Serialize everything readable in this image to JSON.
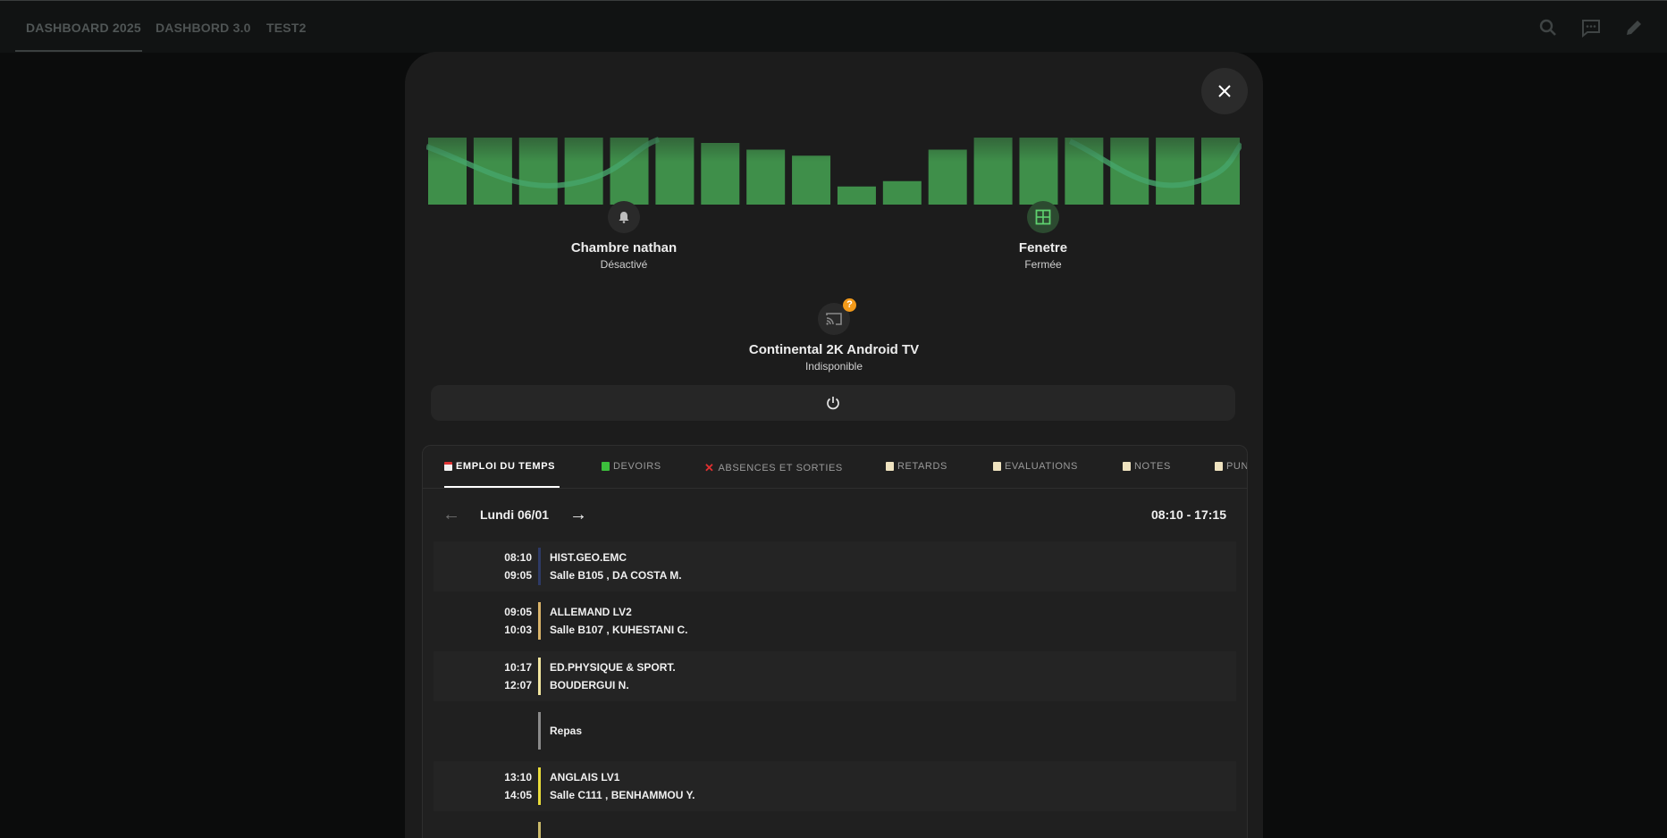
{
  "topbar": {
    "tabs": [
      "DASHBOARD 2025",
      "DASHBORD 3.0",
      "TEST2"
    ],
    "icons": [
      "search-icon",
      "assist-icon",
      "edit-icon"
    ]
  },
  "dialog": {
    "visualizer_bar_levels": [
      1.0,
      1.0,
      1.0,
      1.0,
      1.0,
      1.0,
      0.92,
      0.82,
      0.73,
      0.27,
      0.35,
      0.82,
      1.0,
      1.0,
      1.0,
      1.0,
      1.0,
      1.0
    ],
    "colors": {
      "bar": "#3f8f4a",
      "wave": "#46a56a",
      "accent_green": "#2f6e3b"
    },
    "entities": [
      {
        "name": "Chambre nathan",
        "state": "Désactivé",
        "icon": "bell-icon"
      },
      {
        "name": "Fenetre",
        "state": "Fermée",
        "icon": "window-icon"
      },
      {
        "name": "Continental 2K Android TV",
        "state": "Indisponible",
        "icon": "cast-icon",
        "badge": "?"
      }
    ],
    "power_icon": "power-icon"
  },
  "pronote": {
    "tabs": [
      {
        "label": "EMPLOI DU TEMPS",
        "icon": "calendar-icon"
      },
      {
        "label": "DEVOIRS",
        "icon": "green-square-icon"
      },
      {
        "label": "ABSENCES ET SORTIES",
        "icon": "red-cross-icon"
      },
      {
        "label": "RETARDS",
        "icon": "memo-icon"
      },
      {
        "label": "EVALUATIONS",
        "icon": "memo-icon"
      },
      {
        "label": "NOTES",
        "icon": "memo-icon"
      },
      {
        "label": "PUN",
        "icon": "memo-icon"
      }
    ],
    "day": {
      "prev": "←",
      "title": "Lundi 06/01",
      "next": "→",
      "range": "08:10 - 17:15"
    },
    "lessons": [
      {
        "start": "08:10",
        "end": "09:05",
        "subject": "HIST.GEO.EMC",
        "detail": "Salle B105 , DA COSTA M.",
        "color": "#2e3a66"
      },
      {
        "start": "09:05",
        "end": "10:03",
        "subject": "ALLEMAND LV2",
        "detail": "Salle B107 , KUHESTANI C.",
        "color": "#d9b36a"
      },
      {
        "start": "10:17",
        "end": "12:07",
        "subject": "ED.PHYSIQUE & SPORT.",
        "detail": "BOUDERGUI N.",
        "color": "#f2e6a0"
      },
      {
        "start": "",
        "end": "",
        "subject": "Repas",
        "detail": "",
        "color": "#8a8a8a"
      },
      {
        "start": "13:10",
        "end": "14:05",
        "subject": "ANGLAIS LV1",
        "detail": "Salle C111 , BENHAMMOU Y.",
        "color": "#e9dc3a"
      }
    ]
  }
}
